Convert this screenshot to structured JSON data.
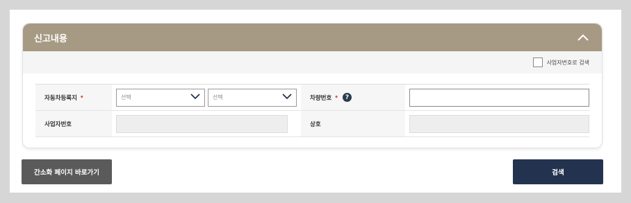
{
  "panel": {
    "title": "신고내용",
    "collapse_icon": "chevron-up-icon",
    "header_color": "#a69a84"
  },
  "options": {
    "business_no_search_label": "사업자번호로 검색",
    "business_no_search_checked": false
  },
  "form": {
    "vehicle_registration": {
      "label": "자동차등록지",
      "required_mark": "•",
      "select1_value": "선택",
      "select2_value": "선택"
    },
    "vehicle_number": {
      "label": "차량번호",
      "required_mark": "•",
      "help_icon": "?",
      "value": ""
    },
    "business_number": {
      "label": "사업자번호",
      "value": ""
    },
    "company_name": {
      "label": "상호",
      "value": ""
    }
  },
  "buttons": {
    "simple_page": "간소화 페이지 바로가기",
    "search": "검색",
    "search_color": "#23334f"
  }
}
